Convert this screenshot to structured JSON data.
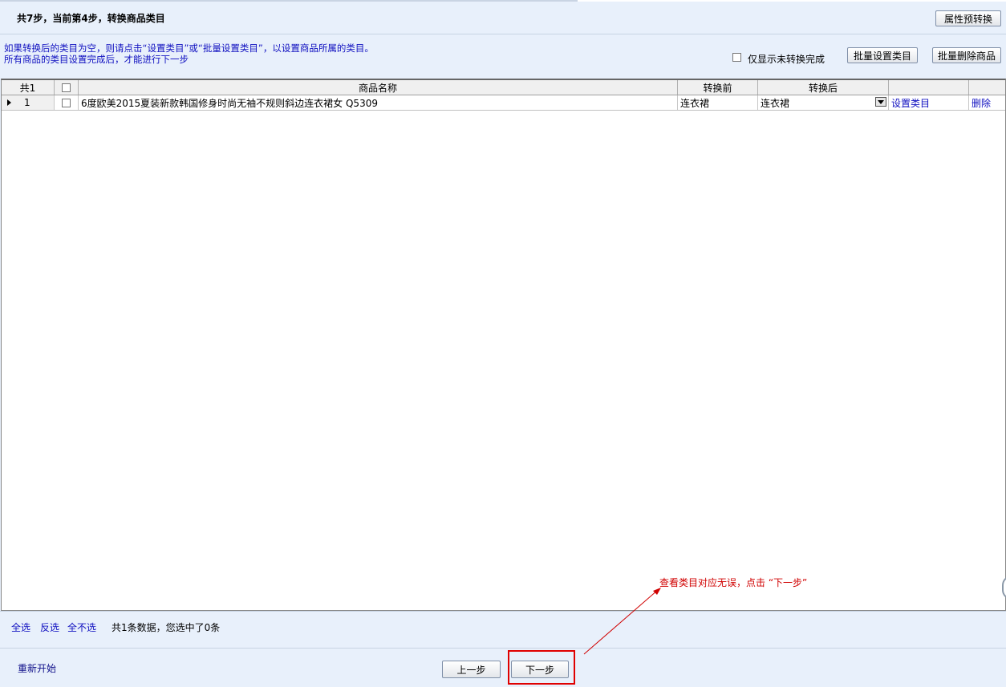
{
  "header": {
    "title": "共7步，当前第4步，转换商品类目",
    "attr_convert_button": "属性预转换"
  },
  "instructions": {
    "line1": "如果转换后的类目为空，则请点击“设置类目”或“批量设置类目”，以设置商品所属的类目。",
    "line2": "所有商品的类目设置完成后，才能进行下一步"
  },
  "toolbar": {
    "only_unconverted_label": "仅显示未转换完成",
    "only_unconverted_checked": false,
    "batch_set_category": "批量设置类目",
    "batch_delete": "批量删除商品"
  },
  "grid": {
    "count_header": "共1",
    "columns": [
      "商品名称",
      "转换前",
      "转换后"
    ],
    "rows": [
      {
        "index": "1",
        "checked": false,
        "name": "6度欧美2015夏装新款韩国修身时尚无袖不规则斜边连衣裙女 Q5309",
        "before": "连衣裙",
        "after": "连衣裙",
        "set_category": "设置类目",
        "delete": "删除"
      }
    ]
  },
  "selection_bar": {
    "select_all": "全选",
    "invert": "反选",
    "select_none": "全不选",
    "summary": "共1条数据，您选中了0条"
  },
  "footer": {
    "restart": "重新开始",
    "prev": "上一步",
    "next": "下一步"
  },
  "annotation": {
    "text": "查看类目对应无误，点击 “下一步”",
    "color": "#d00000"
  }
}
